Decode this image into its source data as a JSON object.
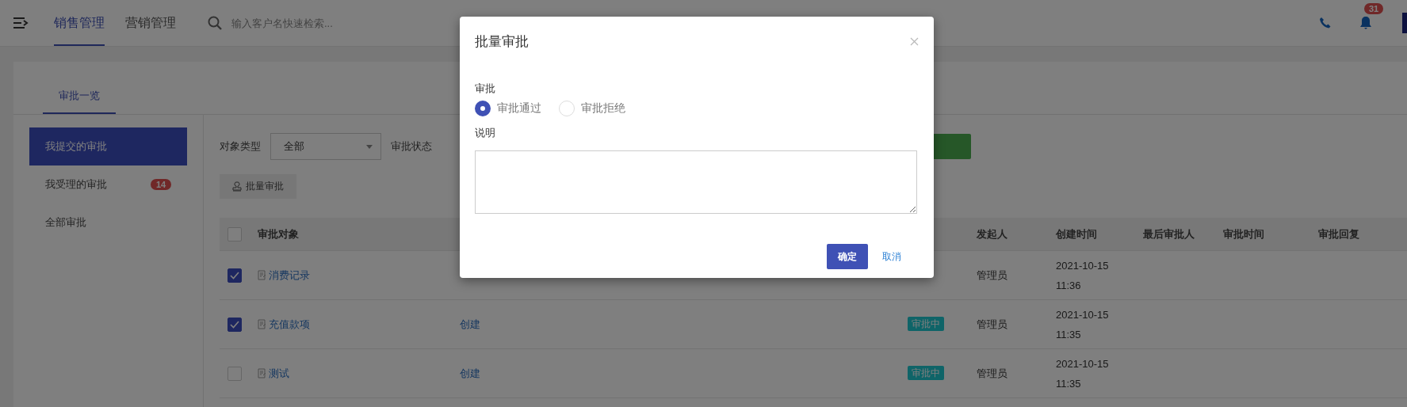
{
  "topbar": {
    "tabs": [
      {
        "label": "销售管理",
        "selected": true
      },
      {
        "label": "营销管理",
        "selected": false
      }
    ],
    "search": {
      "placeholder": "输入客户名快速检索..."
    },
    "notification_count": "31"
  },
  "page_tabs": [
    {
      "label": "审批一览",
      "selected": true
    }
  ],
  "sidebar": {
    "items": [
      {
        "label": "我提交的审批",
        "selected": true
      },
      {
        "label": "我受理的审批",
        "selected": false,
        "badge": "14"
      },
      {
        "label": "全部审批",
        "selected": false
      }
    ]
  },
  "filters": {
    "object_type": {
      "label": "对象类型",
      "value": "全部"
    },
    "status_label": "审批状态"
  },
  "batch_button": "批量审批",
  "table": {
    "header_checked": false,
    "columns": [
      "审批对象",
      "发起人",
      "创建时间",
      "最后审批人",
      "审批时间",
      "审批回复"
    ],
    "rows": [
      {
        "checked": true,
        "object": "消费记录",
        "initiator": "管理员",
        "created": "2021-10-15 11:36"
      },
      {
        "checked": true,
        "object": "充值款项",
        "action": "创建",
        "status": "审批中",
        "initiator": "管理员",
        "created": "2021-10-15 11:35"
      },
      {
        "checked": false,
        "object": "测试",
        "action": "创建",
        "status": "审批中",
        "initiator": "管理员",
        "created": "2021-10-15 11:35"
      }
    ]
  },
  "dialog": {
    "title": "批量审批",
    "fields": [
      {
        "kind": "radio",
        "label": "审批",
        "options": [
          {
            "label": "审批通过",
            "selected": true
          },
          {
            "label": "审批拒绝",
            "selected": false
          }
        ]
      },
      {
        "kind": "textarea",
        "label": "说明"
      }
    ],
    "buttons": [
      {
        "kind": "primary",
        "label": "确定"
      },
      {
        "kind": "link",
        "label": "取消"
      }
    ]
  }
}
